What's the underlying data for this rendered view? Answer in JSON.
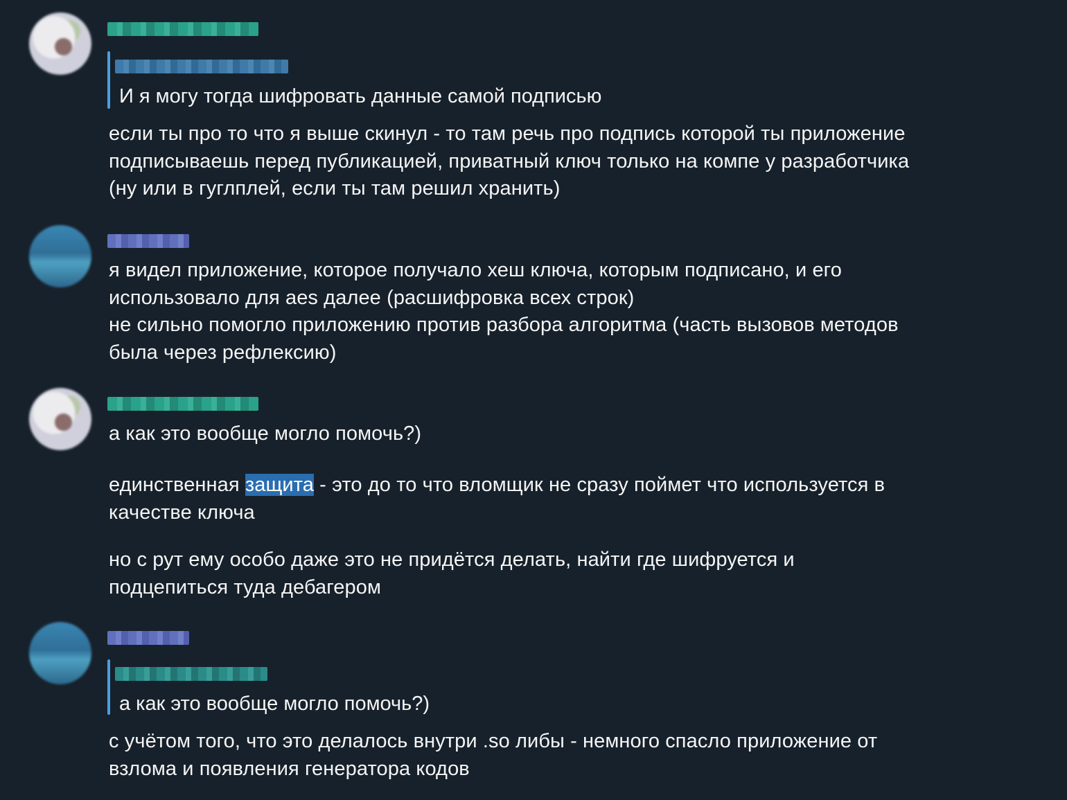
{
  "messages": [
    {
      "reply_quote": "И я могу тогда шифровать данные самой подписью",
      "text": "если ты про то что я выше скинул - то там речь про подпись которой ты приложение\nподписываешь перед публикацией, приватный ключ только на компе у разработчика\n(ну или в гуглплей, если ты там решил хранить)"
    },
    {
      "text": "я видел приложение, которое получало хеш ключа, которым подписано, и его\nиспользовало для aes далее (расшифровка всех строк)\nне сильно помогло приложению против разбора алгоритма (часть вызовов методов\nбыла через рефлексию)"
    },
    {
      "text_1": "а как это вообще могло помочь?)",
      "text_2_before": "единственная ",
      "text_2_highlight": "защита",
      "text_2_after": " - это до то что вломщик не сразу поймет что используется в\nкачестве ключа",
      "text_3": "но с рут ему особо даже это не придётся делать, найти где шифруется и\nподцепиться туда дебагером"
    },
    {
      "reply_quote": "а как это вообще могло помочь?)",
      "text": "с учётом того, что это делалось внутри .so либы - немного спасло приложение от\nвзлома и появления генератора кодов"
    }
  ],
  "colors": {
    "background": "#17212b",
    "text": "#f5f5f5",
    "reply_bar": "#4a9fe0",
    "selection": "#2a6db0"
  }
}
